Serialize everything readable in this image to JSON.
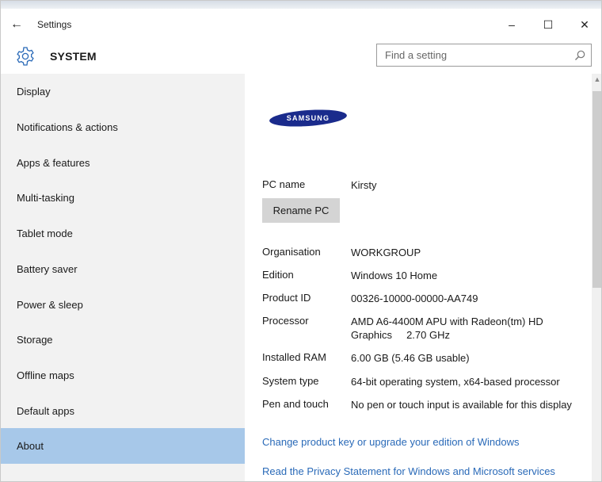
{
  "window": {
    "title": "Settings"
  },
  "controls": {
    "back": "←",
    "minimize": "–",
    "maximize": "☐",
    "close": "✕"
  },
  "header": {
    "title": "SYSTEM",
    "icon": "gear-icon"
  },
  "search": {
    "placeholder": "Find a setting",
    "icon": "search-icon"
  },
  "sidebar": {
    "items": [
      {
        "label": "Display"
      },
      {
        "label": "Notifications & actions"
      },
      {
        "label": "Apps & features"
      },
      {
        "label": "Multi-tasking"
      },
      {
        "label": "Tablet mode"
      },
      {
        "label": "Battery saver"
      },
      {
        "label": "Power & sleep"
      },
      {
        "label": "Storage"
      },
      {
        "label": "Offline maps"
      },
      {
        "label": "Default apps"
      },
      {
        "label": "About",
        "active": true
      }
    ]
  },
  "about": {
    "brand": "SAMSUNG",
    "pc_name": {
      "label": "PC name",
      "value": "Kirsty"
    },
    "rename_button": "Rename PC",
    "specs": [
      {
        "label": "Organisation",
        "value": "WORKGROUP"
      },
      {
        "label": "Edition",
        "value": "Windows 10 Home"
      },
      {
        "label": "Product ID",
        "value": "00326-10000-00000-AA749"
      },
      {
        "label": "Processor",
        "value": "AMD A6-4400M APU with Radeon(tm) HD Graphics     2.70 GHz"
      },
      {
        "label": "Installed RAM",
        "value": "6.00 GB (5.46 GB usable)"
      },
      {
        "label": "System type",
        "value": "64-bit operating system, x64-based processor"
      },
      {
        "label": "Pen and touch",
        "value": "No pen or touch input is available for this display"
      }
    ],
    "links": [
      "Change product key or upgrade your edition of Windows",
      "Read the Privacy Statement for Windows and Microsoft services"
    ]
  },
  "colors": {
    "accent": "#a7c8e9",
    "link": "#2a6ab8",
    "sidebar_bg": "#f2f2f2",
    "brand_blue": "#1a2b8c"
  }
}
